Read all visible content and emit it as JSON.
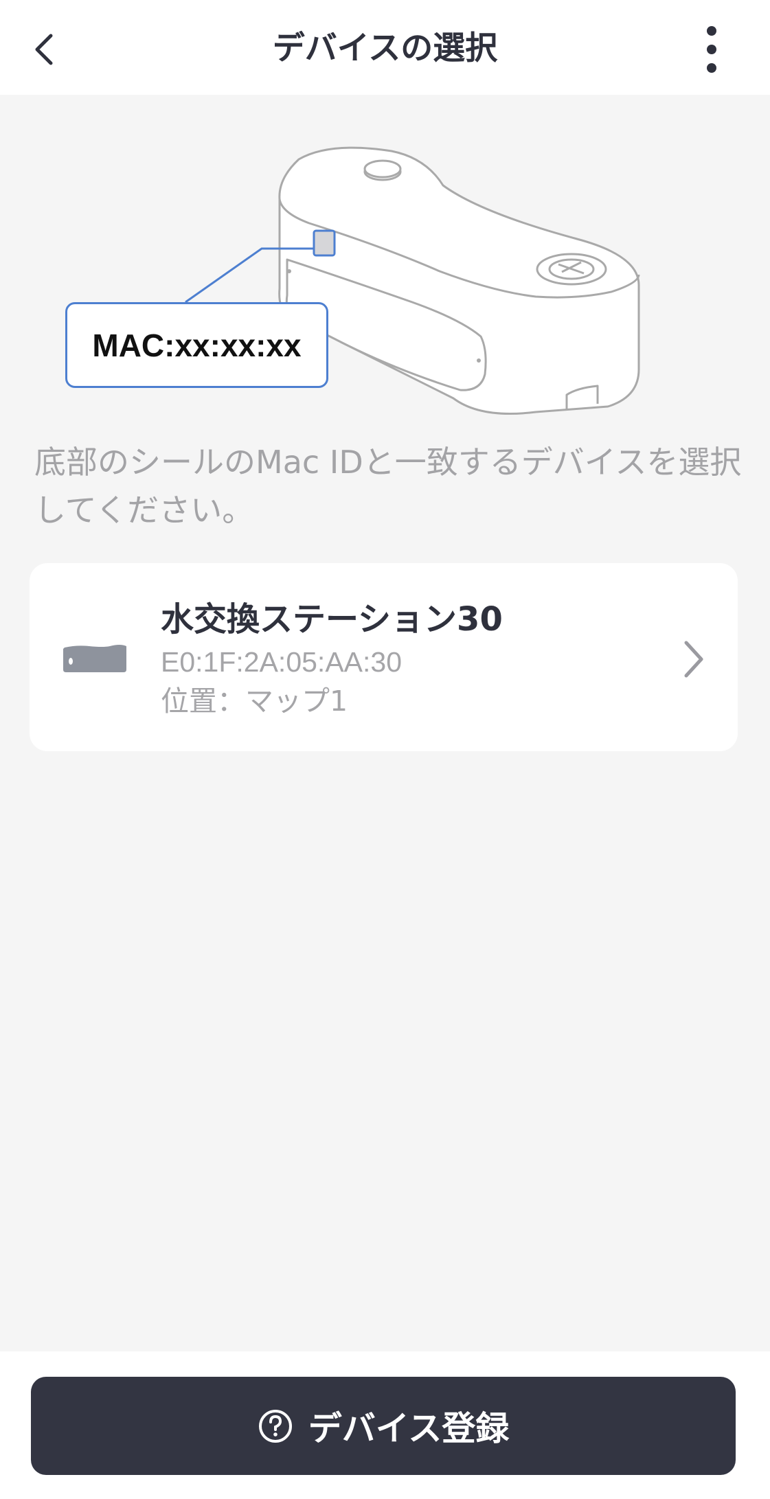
{
  "header": {
    "title": "デバイスの選択",
    "back_icon": "chevron-left-icon",
    "more_icon": "more-vertical-icon"
  },
  "illustration": {
    "mac_label": "MAC:xx:xx:xx"
  },
  "instruction": "底部のシールのMac IDと一致するデバイスを選択してください。",
  "devices": [
    {
      "name": "水交換ステーション30",
      "mac": "E0:1F:2A:05:AA:30",
      "location": "位置：マップ1",
      "icon": "water-station-icon"
    }
  ],
  "footer": {
    "register_label": "デバイス登録",
    "help_icon": "help-circle-icon"
  },
  "colors": {
    "accent": "#333542",
    "highlight": "#4d7fd0",
    "background": "#f5f5f5"
  }
}
